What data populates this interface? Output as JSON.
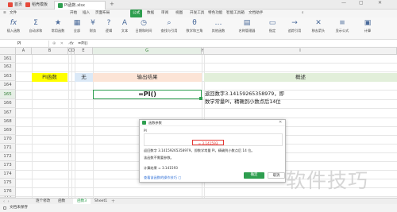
{
  "titlebar": {
    "tabs": [
      {
        "label": "首页",
        "color": "#e64a3b"
      },
      {
        "label": "稻壳模板",
        "color": "#e64a3b"
      },
      {
        "label": "PI函数.xlsx",
        "color": "#2e9e4f"
      }
    ]
  },
  "menubar": {
    "items": [
      "文件",
      "开始",
      "插入",
      "页面布局",
      "公式",
      "数据",
      "审阅",
      "视图",
      "开发工具",
      "特色功能",
      "智能工具箱",
      "文档助手"
    ],
    "active_index": 4
  },
  "ribbon": {
    "buttons": [
      {
        "label": "插入函数",
        "icon": "fx"
      },
      {
        "label": "自动求和",
        "icon": "Σ"
      },
      {
        "label": "常用函数",
        "icon": "★"
      },
      {
        "label": "全部",
        "icon": "▦"
      },
      {
        "label": "财务",
        "icon": "¥"
      },
      {
        "label": "逻辑",
        "icon": "?"
      },
      {
        "label": "文本",
        "icon": "A"
      },
      {
        "label": "日期和时间",
        "icon": "◷"
      },
      {
        "label": "查找与引用",
        "icon": "⌕"
      },
      {
        "label": "数学和三角",
        "icon": "θ"
      },
      {
        "label": "其他函数",
        "icon": "…"
      },
      {
        "label": "名称管理器",
        "icon": "▤"
      },
      {
        "label": "指定",
        "icon": "▭"
      },
      {
        "label": "追踪引用",
        "icon": "→"
      },
      {
        "label": "移去箭头",
        "icon": "✕"
      },
      {
        "label": "显示公式",
        "icon": "≡"
      },
      {
        "label": "计算",
        "icon": "▣"
      }
    ]
  },
  "formula_bar": {
    "name_box": "PI",
    "fx_label": "fx",
    "formula": "=PI()"
  },
  "columns": [
    "A",
    "B",
    "C",
    "D",
    "E",
    "F",
    "G",
    "H",
    "I"
  ],
  "rows": [
    "161",
    "162",
    "163",
    "164",
    "165",
    "166",
    "167",
    "168",
    "169",
    "170",
    "171",
    "172",
    "173",
    "174",
    "175",
    "176",
    "177"
  ],
  "cells": {
    "b163": "PI函数",
    "e163": "无",
    "g163": "输出结果",
    "i163": "概述",
    "g165": "=PI()",
    "i165": "返回数字3.14159265358979，即数学常量PI，精确到小数点后14位"
  },
  "dialog": {
    "title": "函数参数",
    "func_name": "PI",
    "result_line": "= 3.141593",
    "description": "返回数字 3.14159265358979，即数学常量 PI，精确到小数点后 14 位。",
    "no_args": "该函数不需要参数。",
    "calc_result_label": "计算结果 =",
    "calc_result_value": "3.141593",
    "help_link": "查看该函数的操作技巧",
    "ok_label": "确定",
    "cancel_label": "取消"
  },
  "sheets": [
    "逐个修改",
    "函数",
    "函数3",
    "Sheet1"
  ],
  "active_sheet_index": 2,
  "status": {
    "left_text": "文档未保存"
  },
  "watermark": "软件技巧",
  "colors": {
    "accent": "#2e9e4f",
    "yellow_fill": "#ffff00",
    "light_blue_fill": "#dbe9f7",
    "peach_fill": "#fce4d6",
    "light_green_fill": "#e2efda",
    "result_highlight": "#e53935"
  }
}
